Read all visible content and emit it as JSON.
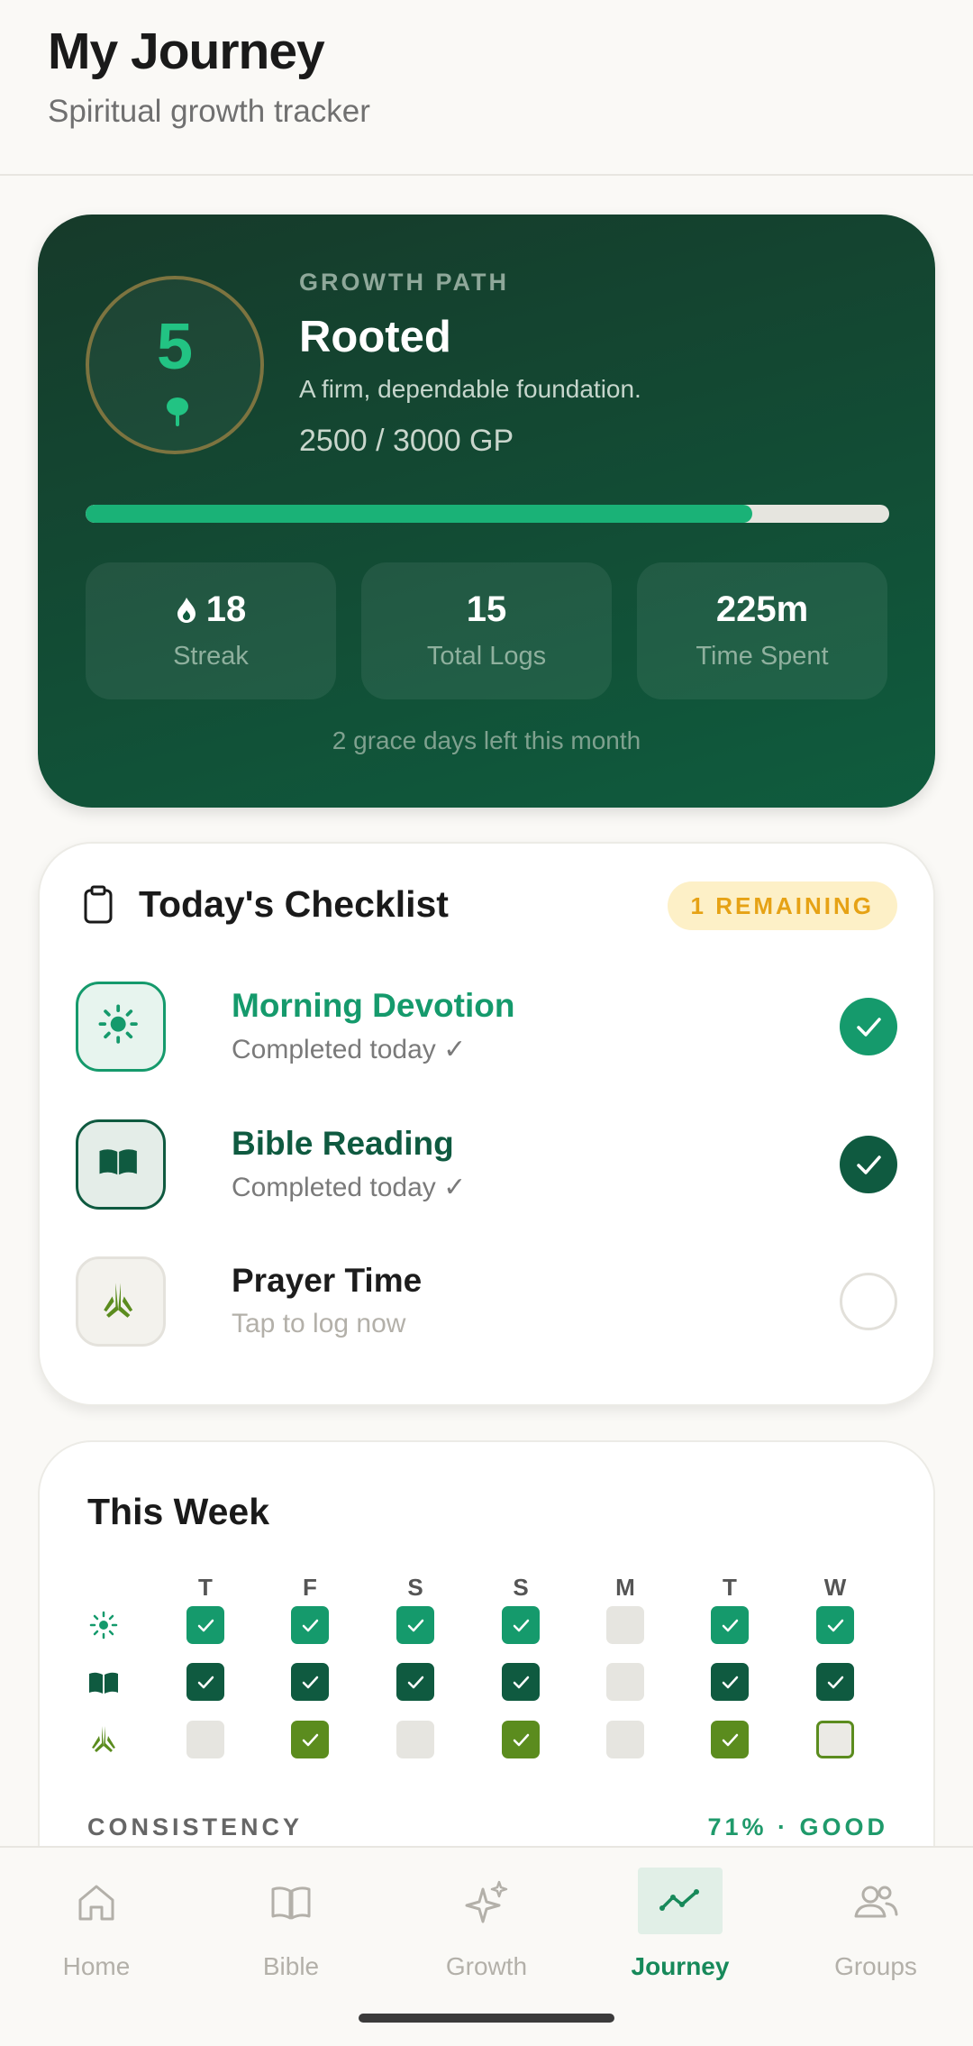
{
  "header": {
    "title": "My Journey",
    "subtitle": "Spiritual growth tracker"
  },
  "growth": {
    "level": "5",
    "label": "GROWTH PATH",
    "title": "Rooted",
    "description": "A firm, dependable foundation.",
    "points": "2500 / 3000 GP",
    "progress": 0.83,
    "stats": [
      {
        "value": "18",
        "label": "Streak",
        "icon": "flame-icon"
      },
      {
        "value": "15",
        "label": "Total Logs"
      },
      {
        "value": "225m",
        "label": "Time Spent"
      }
    ],
    "grace_note": "2 grace days left this month"
  },
  "checklist": {
    "title": "Today's Checklist",
    "badge": "1 REMAINING",
    "tasks": [
      {
        "name": "Morning Devotion",
        "status": "Completed today ✓",
        "done": true,
        "icon": "sun-icon",
        "color": "#159a6c"
      },
      {
        "name": "Bible Reading",
        "status": "Completed today ✓",
        "done": true,
        "icon": "book-icon",
        "color": "#0f5a40"
      },
      {
        "name": "Prayer Time",
        "status": "Tap to log now",
        "done": false,
        "icon": "praying-hands-icon",
        "color": "#1c1c1c"
      }
    ]
  },
  "week": {
    "title": "This Week",
    "days": [
      "T",
      "F",
      "S",
      "S",
      "M",
      "T",
      "W"
    ],
    "rows": [
      {
        "icon": "sun-icon",
        "color": "#159a6c",
        "values": [
          1,
          1,
          1,
          1,
          0,
          1,
          1
        ]
      },
      {
        "icon": "book-icon",
        "color": "#0f5a40",
        "values": [
          1,
          1,
          1,
          1,
          0,
          1,
          1
        ]
      },
      {
        "icon": "praying-hands-icon",
        "color": "#5b8c1e",
        "values": [
          0,
          1,
          0,
          1,
          0,
          1,
          0
        ]
      }
    ],
    "consistency_label": "CONSISTENCY",
    "consistency_value": "71% · GOOD"
  },
  "nav": {
    "items": [
      {
        "label": "Home",
        "icon": "home-icon"
      },
      {
        "label": "Bible",
        "icon": "book-icon"
      },
      {
        "label": "Growth",
        "icon": "sparkles-icon"
      },
      {
        "label": "Journey",
        "icon": "trend-icon",
        "active": true
      },
      {
        "label": "Groups",
        "icon": "users-icon"
      }
    ]
  },
  "colors": {
    "accent": "#17895a",
    "card_dark": "#0f5c3e",
    "badge_bg": "#fdf0c7",
    "badge_text": "#e6a215"
  }
}
